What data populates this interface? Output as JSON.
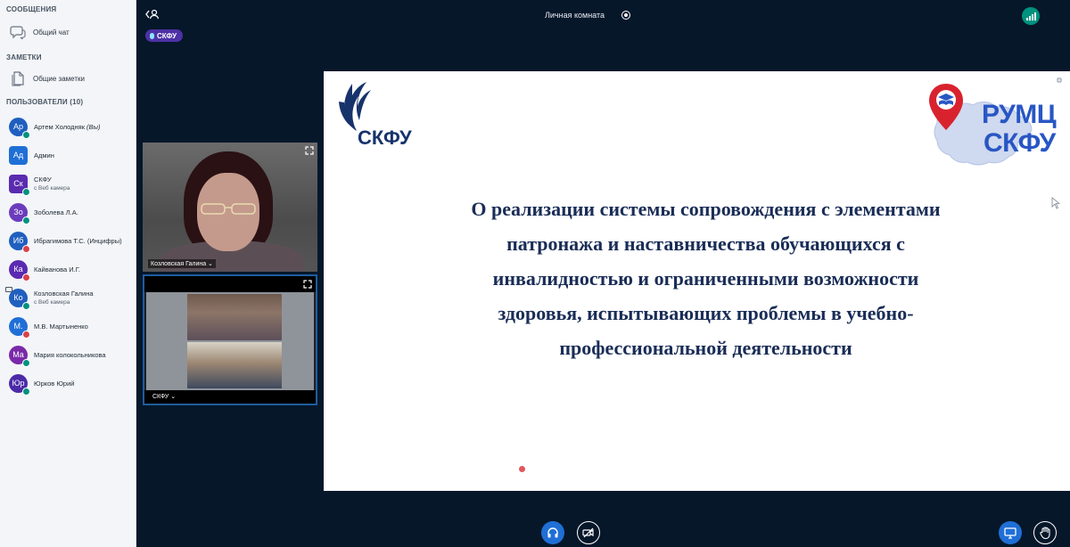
{
  "sidebar": {
    "messages_title": "СООБЩЕНИЯ",
    "public_chat": "Общий чат",
    "notes_title": "ЗАМЕТКИ",
    "shared_notes": "Общие заметки",
    "users_title": "ПОЛЬЗОВАТЕЛИ (10)",
    "users": [
      {
        "initials": "Ар",
        "name": "Артем Холодняк",
        "suffix": "(Вы)",
        "sub": "",
        "color": "#1f5fbf",
        "square": false,
        "badge": "#00917f"
      },
      {
        "initials": "Ад",
        "name": "Админ",
        "suffix": "",
        "sub": "",
        "color": "#1f6fd6",
        "square": true,
        "badge": ""
      },
      {
        "initials": "Ск",
        "name": "СКФУ",
        "suffix": "",
        "sub": "с Веб камера",
        "color": "#5a2bb0",
        "square": true,
        "badge": "#00917f"
      },
      {
        "initials": "Зо",
        "name": "Зоболева Л.А.",
        "suffix": "",
        "sub": "",
        "color": "#6b3bbd",
        "square": false,
        "badge": "#00917f"
      },
      {
        "initials": "Иб",
        "name": "Ибрагимова Т.С. (Инцифры)",
        "suffix": "",
        "sub": "",
        "color": "#1f5fbf",
        "square": false,
        "badge": "#d9414b"
      },
      {
        "initials": "Ка",
        "name": "Кайванова И.Г.",
        "suffix": "",
        "sub": "",
        "color": "#5a2bb0",
        "square": false,
        "badge": "#d9414b"
      },
      {
        "initials": "Ко",
        "name": "Козловская Галина",
        "suffix": "",
        "sub": "с Веб камера",
        "color": "#1f5fbf",
        "square": false,
        "badge": "#00917f"
      },
      {
        "initials": "М.",
        "name": "М.В. Мартыненко",
        "suffix": "",
        "sub": "",
        "color": "#1f6fd6",
        "square": false,
        "badge": "#d9414b"
      },
      {
        "initials": "Ма",
        "name": "Мария колокольникова",
        "suffix": "",
        "sub": "",
        "color": "#7a2aa8",
        "square": false,
        "badge": "#00917f"
      },
      {
        "initials": "Юр",
        "name": "Юрков Юрий",
        "suffix": "",
        "sub": "",
        "color": "#4b2ba8",
        "square": false,
        "badge": "#00917f"
      }
    ]
  },
  "topbar": {
    "room_title": "Личная комната",
    "room_badge": "СКФУ"
  },
  "videos": {
    "v1_label": "Козловская Галина ⌄",
    "v2_label": "СКФУ ⌄"
  },
  "slide": {
    "logo_left": "СКФУ",
    "logo_right_top": "РУМЦ",
    "logo_right_bottom": "СКФУ",
    "text": "О реализации системы сопровождения с элементами\nпатронажа и наставничества обучающихся с\nинвалидностью и ограниченными возможности\nздоровья, испытывающих проблемы в учебно-\nпрофессиональной деятельности"
  },
  "colors": {
    "background": "#06172a",
    "accent": "#1f6fd6",
    "ok": "#00917f",
    "muted": "#d9414b",
    "slide_text": "#1a2d57"
  }
}
